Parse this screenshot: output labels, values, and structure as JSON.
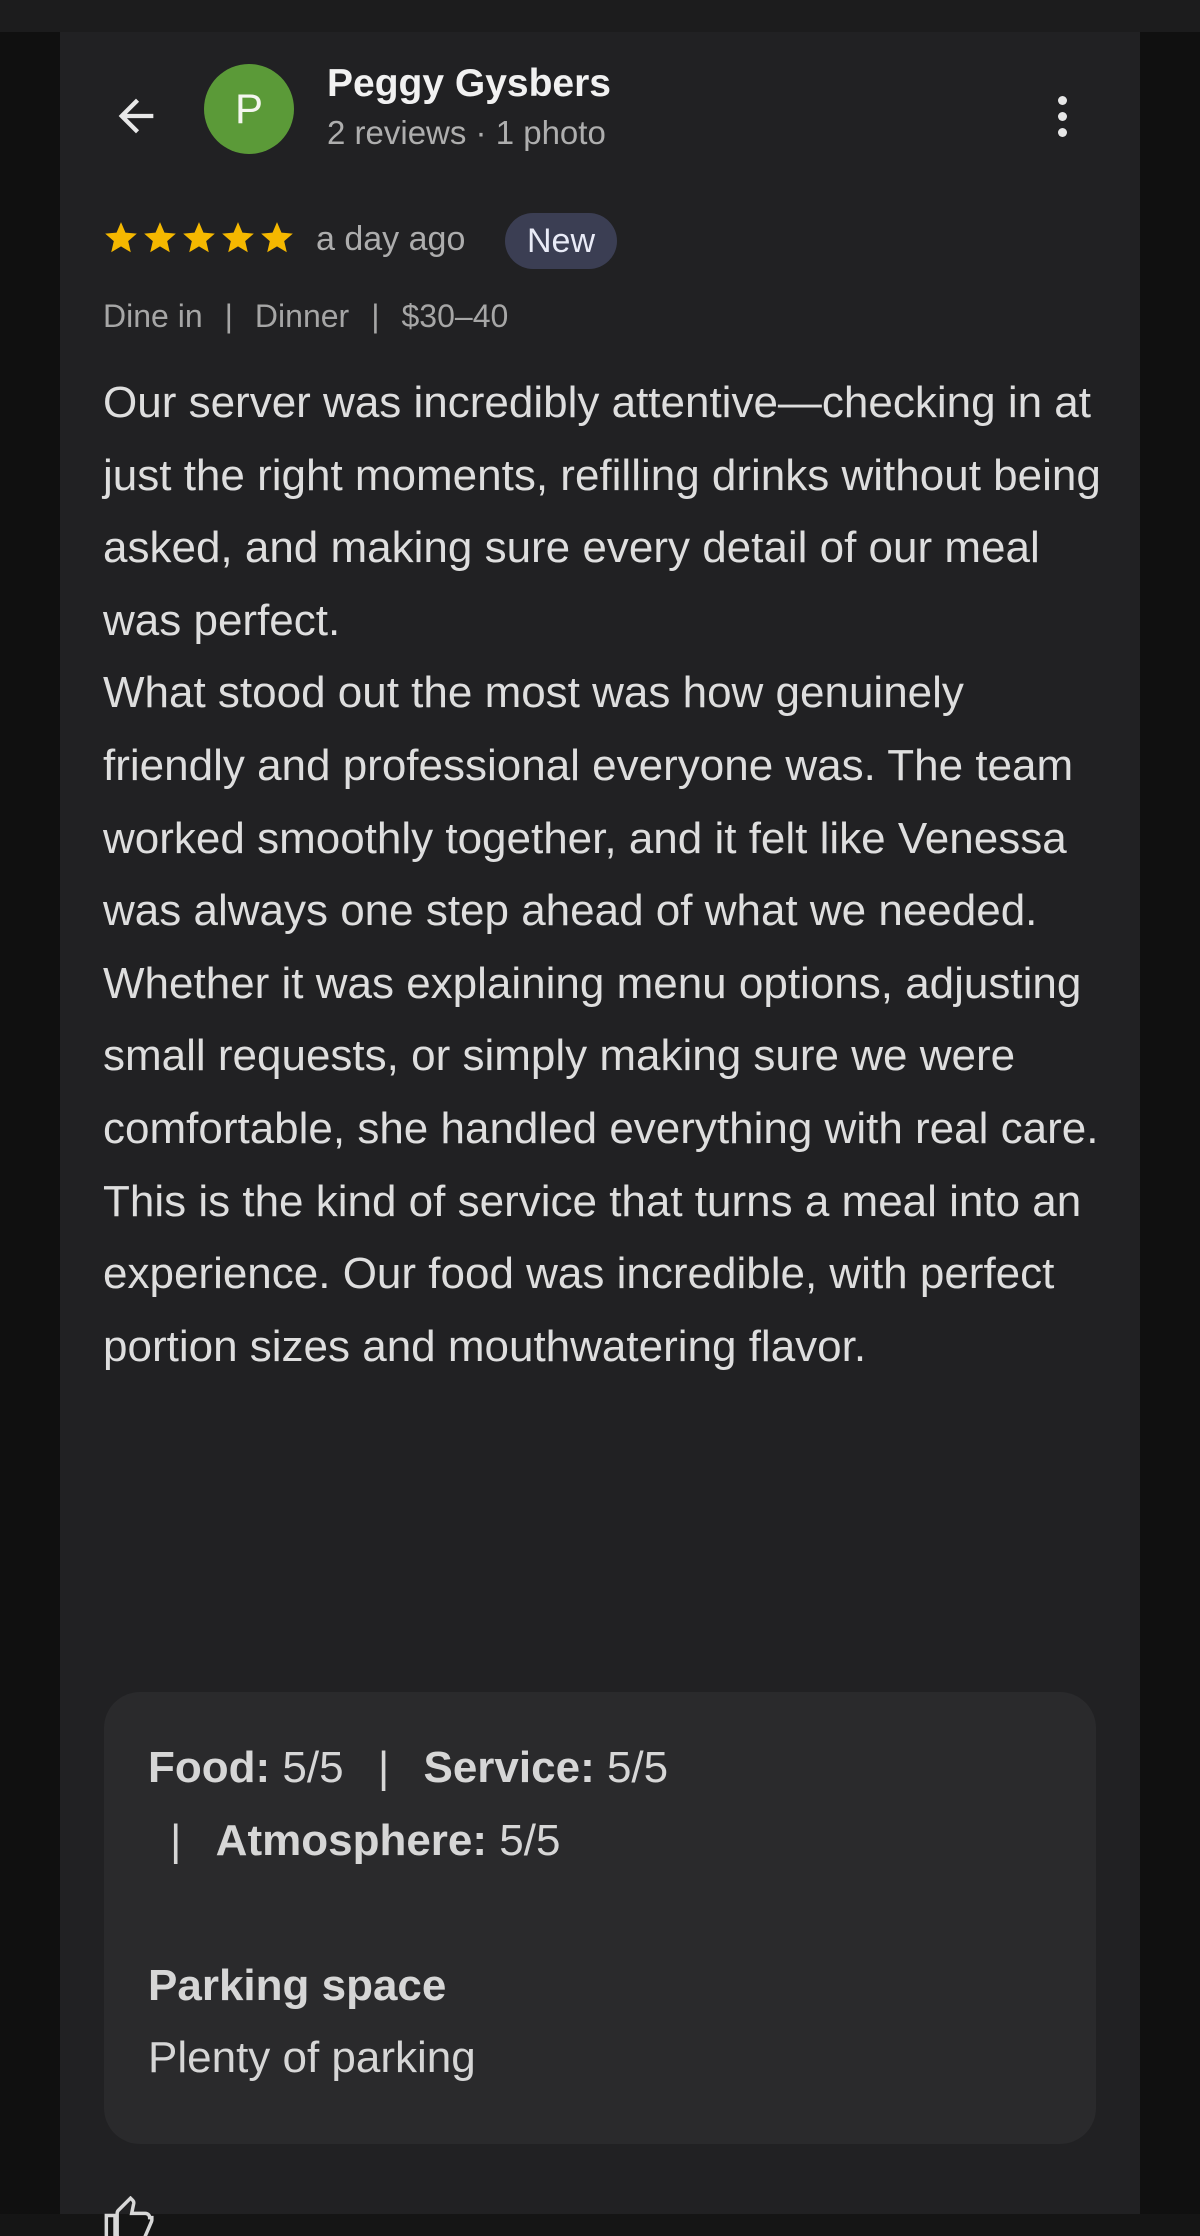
{
  "reviewer": {
    "avatar_letter": "P",
    "avatar_color": "#5b9a38",
    "name": "Peggy Gysbers",
    "meta": "2 reviews · 1 photo"
  },
  "icons": {
    "back": "arrow-left-icon",
    "more": "more-vert-icon",
    "star": "star-icon",
    "bottom": "thumb-up-icon"
  },
  "review": {
    "rating": 5,
    "star_color": "#f5b800",
    "time_ago": "a day ago",
    "badge": "New",
    "tags": [
      "Dine in",
      "Dinner",
      "$30–40"
    ],
    "tag_separator": "|",
    "paragraphs": [
      "Our server was incredibly attentive—checking in at just the right moments, refilling drinks without being asked, and making sure every detail of our meal was perfect.",
      "What stood out the most was how genuinely friendly and professional everyone was. The team worked smoothly together, and it felt like Venessa was always one step ahead of what we needed.",
      "Whether it was explaining menu options, adjusting small requests, or simply making sure we were comfortable, she handled everything with real care.",
      "This is the kind of service that turns a meal into an experience. Our food was incredible, with perfect portion sizes and mouthwatering flavor."
    ]
  },
  "ratings": {
    "food_label": "Food:",
    "food_value": "5/5",
    "service_label": "Service:",
    "service_value": "5/5",
    "atmosphere_label": "Atmosphere:",
    "atmosphere_value": "5/5",
    "separator": "|",
    "parking_label": "Parking space",
    "parking_value": "Plenty of parking"
  }
}
